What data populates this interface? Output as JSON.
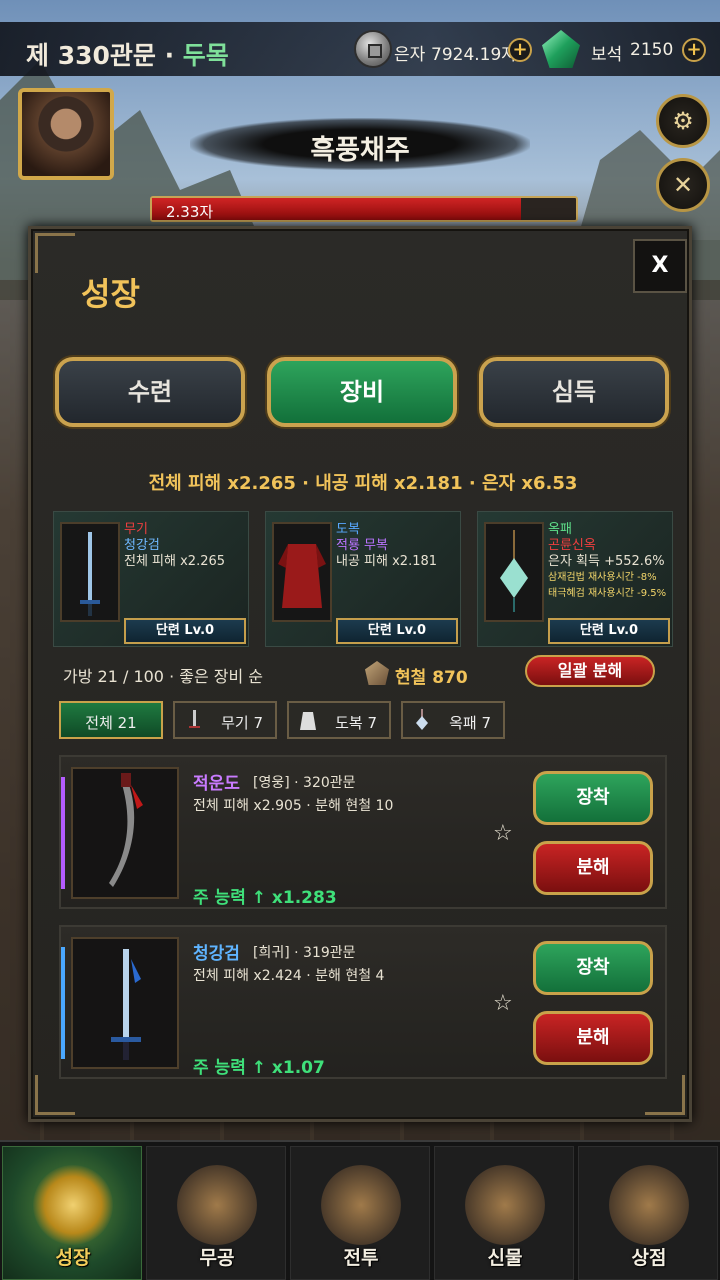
{
  "topbar": {
    "stage_label": "제 330관문 · ",
    "boss_short": "두목",
    "silver_label": "은자",
    "silver_value": "7924.19자",
    "gem_label": "보석",
    "gem_value": "2150",
    "plus": "+"
  },
  "boss": {
    "name": "흑풍채주",
    "hp_text": "2.33자",
    "hp_fraction": 0.87
  },
  "side_buttons": [
    "⚙",
    "✕"
  ],
  "panel": {
    "title": "성장",
    "close": "X",
    "tabs": [
      "수련",
      "장비",
      "심득"
    ],
    "active_tab": "장비",
    "stats_line": "전체 피해 x2.265 · 내공 피해 x2.181 · 은자 x6.53"
  },
  "equipped": [
    {
      "slot": "무기",
      "name": "청강검",
      "effect": "전체 피해 x2.265",
      "refine": "단련 Lv.0"
    },
    {
      "slot": "도복",
      "name": "적룡 무복",
      "effect": "내공 피해 x2.181",
      "refine": "단련 Lv.0"
    },
    {
      "slot": "옥패",
      "name": "곤륜신옥",
      "effect": "은자 획득 +552.6%",
      "sub1": "삼재검법 재사용시간 -8%",
      "sub2": "태극혜검 재사용시간 -9.5%",
      "refine": "단련 Lv.0"
    }
  ],
  "bag": {
    "info": "가방 21 / 100 · 좋은 장비 순",
    "ore": "현철 870",
    "bulk_button": "일괄 분해"
  },
  "filters": [
    {
      "label": "전체 21",
      "icon": ""
    },
    {
      "label": "무기 7",
      "icon": "sword-icon"
    },
    {
      "label": "도복 7",
      "icon": "robe-icon"
    },
    {
      "label": "옥패 7",
      "icon": "jade-icon"
    }
  ],
  "items": [
    {
      "name": "적운도",
      "meta": "[영웅] · 320관문",
      "desc": "전체 피해 x2.905 · 분해 현철 10",
      "power": "주 능력 ↑ x1.283",
      "star": "☆",
      "equip": "장착",
      "dismantle": "분해",
      "rarity_color": "#b45cff"
    },
    {
      "name": "청강검",
      "meta": "[희귀] · 319관문",
      "desc": "전체 피해 x2.424 · 분해 현철 4",
      "power": "주 능력 ↑ x1.07",
      "star": "☆",
      "equip": "장착",
      "dismantle": "분해",
      "rarity_color": "#4aa8ff"
    }
  ],
  "nav": [
    "성장",
    "무공",
    "전투",
    "신물",
    "상점"
  ],
  "colors": {
    "accent_gold": "#f1c35a",
    "active_green": "#2ea45c",
    "danger_red": "#c92424"
  }
}
